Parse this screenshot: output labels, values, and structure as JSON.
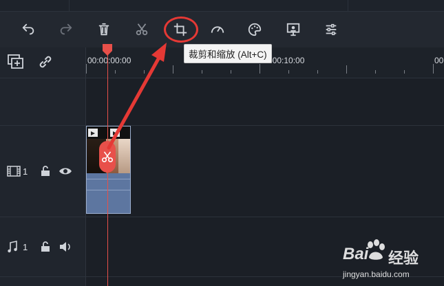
{
  "toolbar": {
    "buttons": [
      {
        "name": "undo-icon"
      },
      {
        "name": "redo-icon"
      },
      {
        "name": "delete-icon"
      },
      {
        "name": "cut-icon"
      },
      {
        "name": "crop-icon"
      },
      {
        "name": "speed-icon"
      },
      {
        "name": "color-icon"
      },
      {
        "name": "screen-record-icon"
      },
      {
        "name": "adjust-icon"
      }
    ],
    "tooltip": "裁剪和缩放 (Alt+C)"
  },
  "timeline": {
    "ruler_labels": [
      "00:00:00:00",
      "00:00:10:00",
      "00"
    ],
    "tracks": [
      {
        "type": "video",
        "number": "1"
      },
      {
        "type": "audio",
        "number": "1"
      }
    ]
  },
  "watermark": {
    "brand": "Bai",
    "brand2": "经验",
    "url": "jingyan.baidu.com"
  },
  "colors": {
    "playhead": "#e8504a",
    "annotation": "#e53935",
    "clip": "#5d76a0"
  }
}
